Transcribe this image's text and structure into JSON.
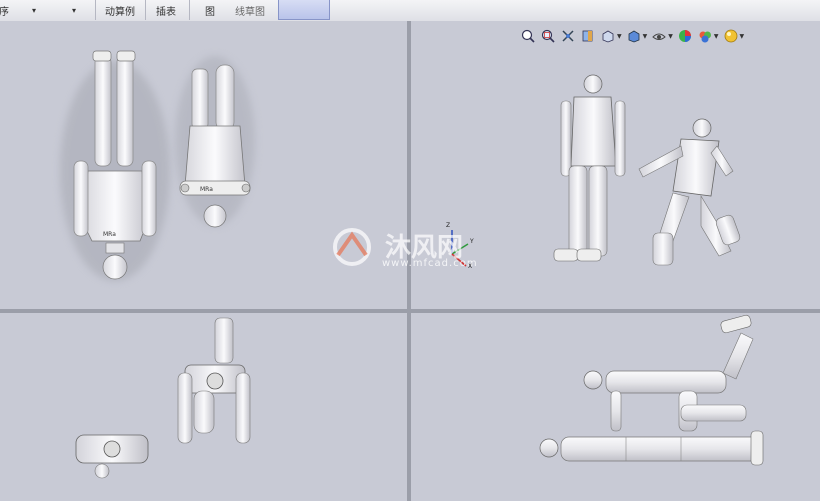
{
  "toolbar": {
    "partial_left_label": "序",
    "dropdown1_label": "▾",
    "dropdown2_label": "▾",
    "btn_motion_study": "动算例",
    "btn_expand": "插表",
    "btn_graph": "图",
    "btn_sketch": "线草图"
  },
  "view_toolbar": {
    "icons": [
      "zoom-to-fit-icon",
      "zoom-area-icon",
      "previous-view-icon",
      "section-view-icon",
      "view-orientation-icon",
      "display-style-icon",
      "hide-show-icon",
      "edit-appearance-icon",
      "apply-scene-icon",
      "view-settings-icon"
    ]
  },
  "watermark": {
    "text": "沐风网",
    "url": "www.mfcad.com"
  },
  "triad": {
    "x": "X",
    "y": "Y",
    "z": "Z"
  },
  "colors": {
    "background": "#c8cad5",
    "splitter": "#9b9ea9",
    "toolbar": "#e9eaee",
    "active_tab": "#c6cfef",
    "model": "#f2f2f4"
  }
}
